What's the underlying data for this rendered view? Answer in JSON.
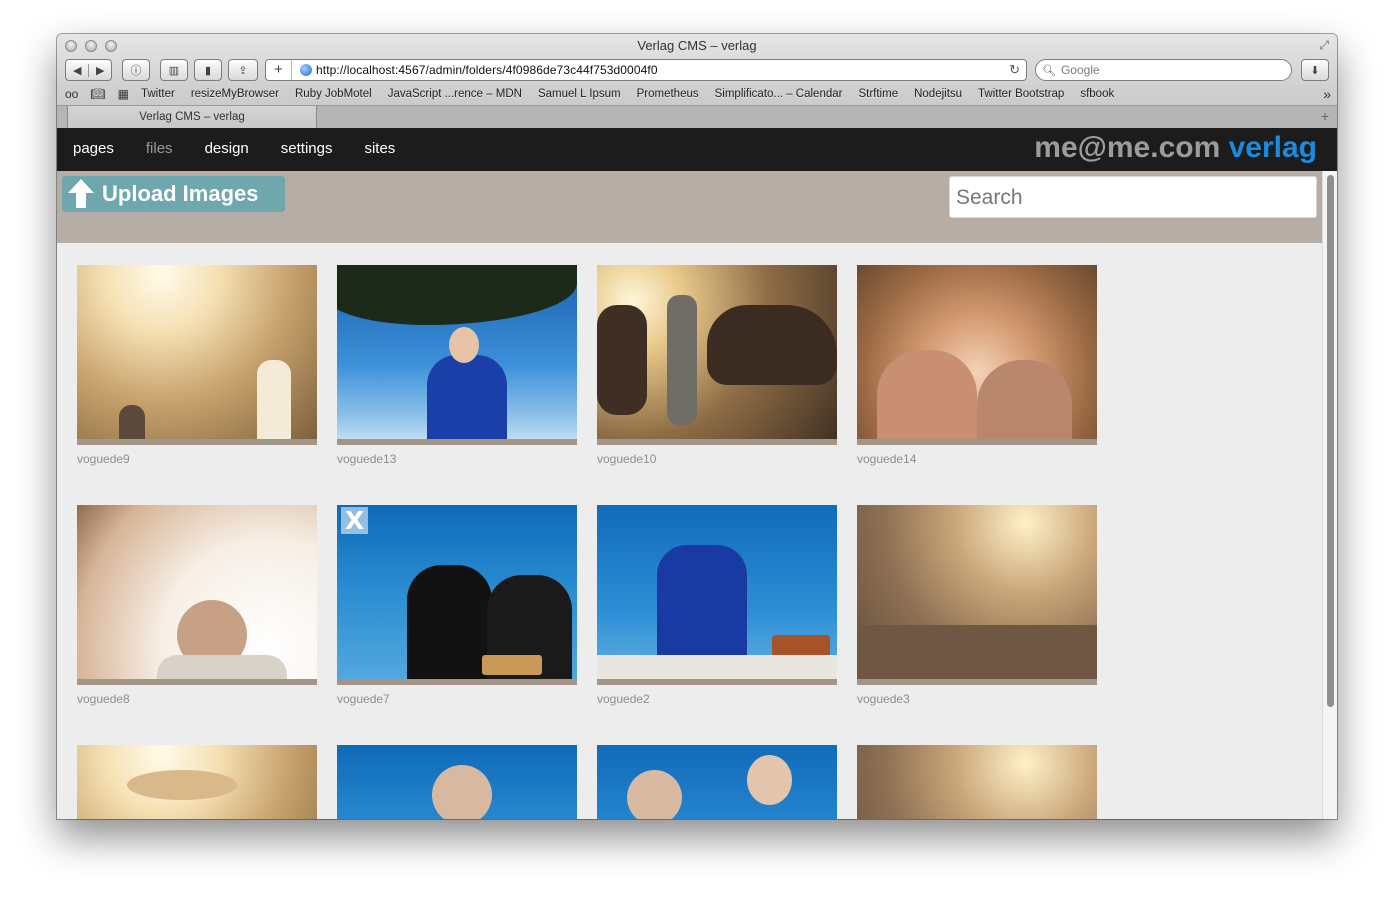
{
  "window": {
    "title": "Verlag CMS – verlag"
  },
  "toolbar": {
    "url": "http://localhost:4567/admin/folders/4f0986de73c44f753d0004f0",
    "search_placeholder": "Google"
  },
  "bookmarks": [
    "Twitter",
    "resizeMyBrowser",
    "Ruby JobMotel",
    "JavaScript ...rence – MDN",
    "Samuel L Ipsum",
    "Prometheus",
    "Simplificato... – Calendar",
    "Strftime",
    "Nodejitsu",
    "Twitter Bootstrap",
    "sfbook"
  ],
  "tab": {
    "title": "Verlag CMS – verlag"
  },
  "nav": {
    "links": [
      "pages",
      "files",
      "design",
      "settings",
      "sites"
    ],
    "brand_primary": "me@me.com",
    "brand_secondary": "verlag"
  },
  "actions": {
    "upload_label": "Upload Images",
    "search_placeholder": "Search"
  },
  "images": [
    {
      "caption": "voguede9"
    },
    {
      "caption": "voguede13"
    },
    {
      "caption": "voguede10"
    },
    {
      "caption": "voguede14"
    },
    {
      "caption": "voguede8"
    },
    {
      "caption": "voguede7",
      "delete_label": "X"
    },
    {
      "caption": "voguede2"
    },
    {
      "caption": "voguede3"
    }
  ],
  "colors": {
    "brand_accent": "#1b8be0",
    "upload_button": "#6fa7ae",
    "action_bar": "#b6ada6",
    "nav_bg": "#1c1c1c"
  }
}
